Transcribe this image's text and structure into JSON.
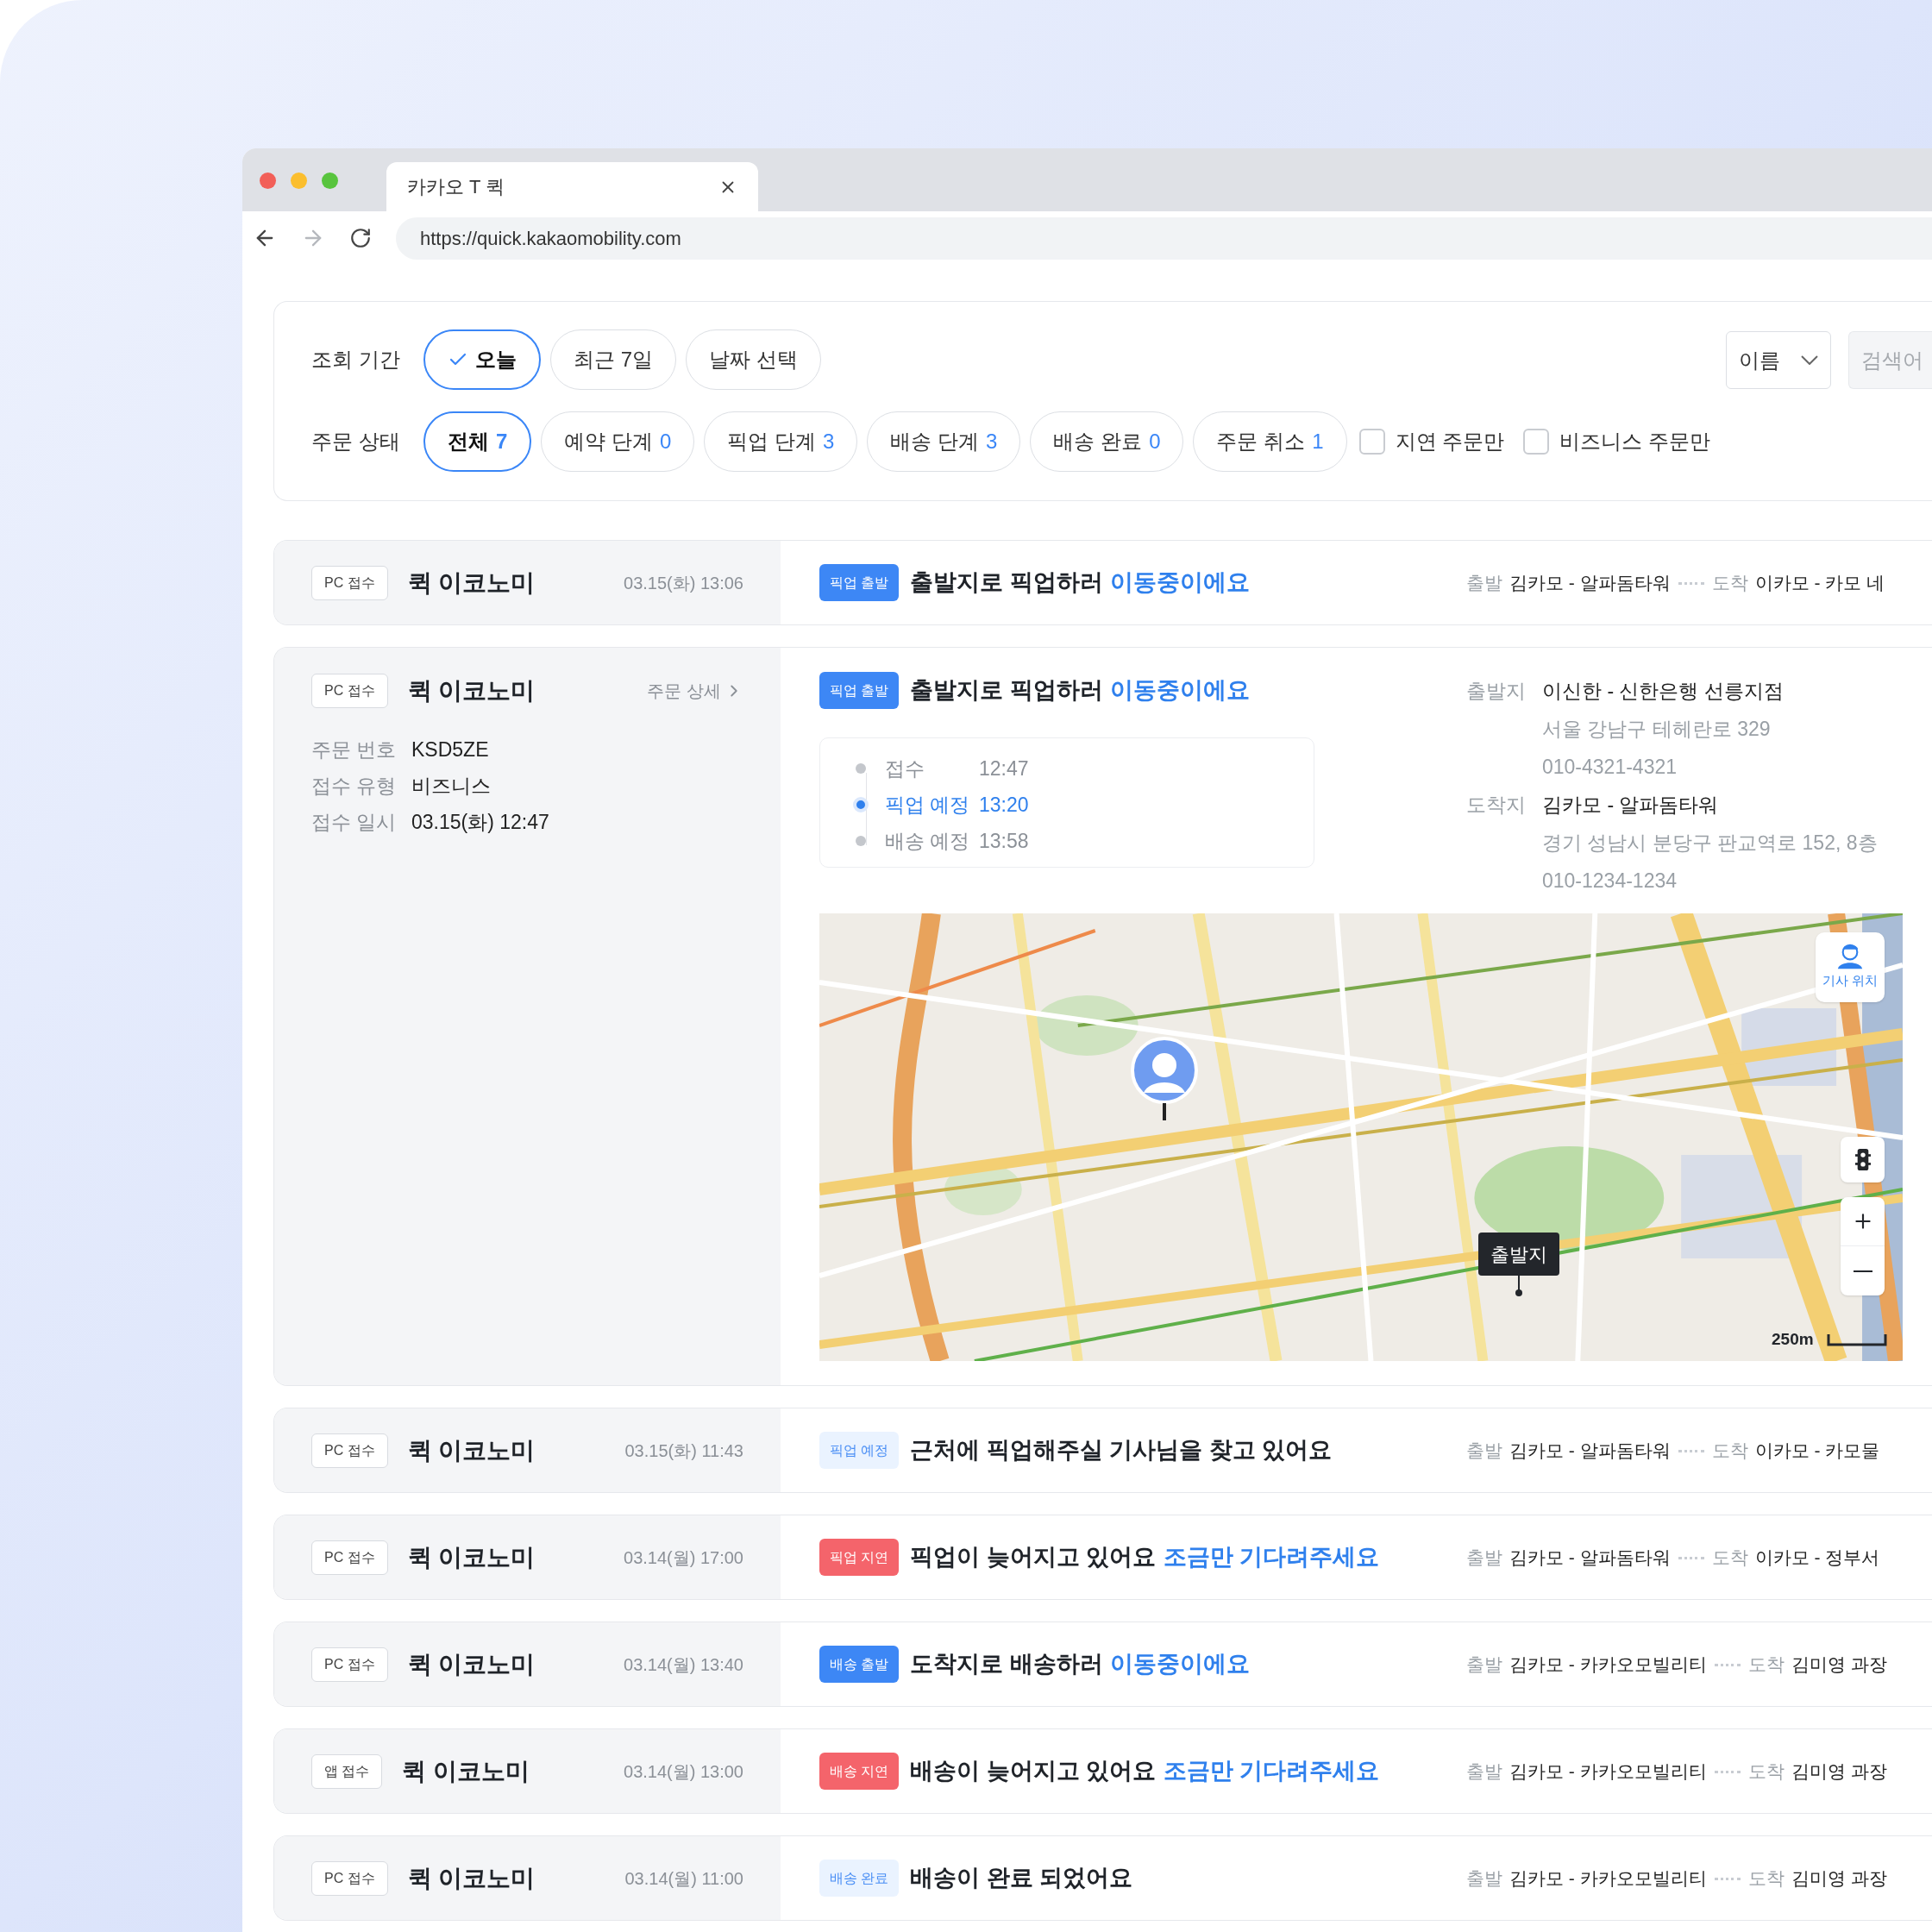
{
  "browser": {
    "tab_title": "카카오 T 퀵",
    "url": "https://quick.kakaomobility.com"
  },
  "filters": {
    "period_label": "조회 기간",
    "period_options": [
      {
        "label": "오늘",
        "selected": true
      },
      {
        "label": "최근 7일",
        "selected": false
      },
      {
        "label": "날짜 선택",
        "selected": false
      }
    ],
    "sort": "이름",
    "search_placeholder": "검색어",
    "status_label": "주문 상태",
    "status_options": [
      {
        "label": "전체",
        "count": "7",
        "selected": true
      },
      {
        "label": "예약 단계",
        "count": "0",
        "selected": false
      },
      {
        "label": "픽업 단계",
        "count": "3",
        "selected": false
      },
      {
        "label": "배송 단계",
        "count": "3",
        "selected": false
      },
      {
        "label": "배송 완료",
        "count": "0",
        "selected": false
      },
      {
        "label": "주문 취소",
        "count": "1",
        "selected": false
      }
    ],
    "checkboxes": [
      {
        "label": "지연 주문만",
        "checked": false
      },
      {
        "label": "비즈니스 주문만",
        "checked": false
      }
    ]
  },
  "orders": [
    {
      "expanded": false,
      "channel": "PC 접수",
      "service": "퀵 이코노미",
      "time": "03.15(화) 13:06",
      "badge": {
        "label": "픽업 출발",
        "kind": "solid"
      },
      "message": "출발지로 픽업하러",
      "highlight": "이동중이에요",
      "from_label": "출발",
      "from": "김카모 - 알파돔타워",
      "to_label": "도착",
      "to": "이카모 - 카모 네"
    },
    {
      "expanded": true,
      "channel": "PC 접수",
      "service": "퀵 이코노미",
      "detail_link": "주문 상세",
      "badge": {
        "label": "픽업 출발",
        "kind": "solid"
      },
      "message": "출발지로 픽업하러",
      "highlight": "이동중이에요",
      "info": [
        {
          "label": "주문 번호",
          "value": "KSD5ZE"
        },
        {
          "label": "접수 유형",
          "value": "비즈니스"
        },
        {
          "label": "접수 일시",
          "value": "03.15(화) 12:47"
        }
      ],
      "timeline": [
        {
          "label": "접수",
          "time": "12:47",
          "current": false
        },
        {
          "label": "픽업 예정",
          "time": "13:20",
          "current": true
        },
        {
          "label": "배송 예정",
          "time": "13:58",
          "current": false
        }
      ],
      "places": [
        {
          "label": "출발지",
          "name": "이신한 - 신한은행 선릉지점",
          "address": "서울 강남구 테헤란로 329",
          "phone": "010-4321-4321"
        },
        {
          "label": "도착지",
          "name": "김카모 - 알파돔타워",
          "address": "경기 성남시 분당구 판교역로 152, 8층",
          "phone": "010-1234-1234"
        }
      ],
      "map": {
        "driver_button": "기사 위치",
        "origin_label": "출발지",
        "scale": "250m"
      }
    },
    {
      "expanded": false,
      "channel": "PC 접수",
      "service": "퀵 이코노미",
      "time": "03.15(화) 11:43",
      "badge": {
        "label": "픽업 예정",
        "kind": "soft"
      },
      "message": "근처에 픽업해주실 기사님을 찾고 있어요",
      "from_label": "출발",
      "from": "김카모 - 알파돔타워",
      "to_label": "도착",
      "to": "이카모 - 카모물"
    },
    {
      "expanded": false,
      "channel": "PC 접수",
      "service": "퀵 이코노미",
      "time": "03.14(월) 17:00",
      "badge": {
        "label": "픽업 지연",
        "kind": "alert"
      },
      "message": "픽업이 늦어지고 있어요",
      "highlight": "조금만 기다려주세요",
      "from_label": "출발",
      "from": "김카모 - 알파돔타워",
      "to_label": "도착",
      "to": "이카모 - 정부서"
    },
    {
      "expanded": false,
      "channel": "PC 접수",
      "service": "퀵 이코노미",
      "time": "03.14(월) 13:40",
      "badge": {
        "label": "배송 출발",
        "kind": "solid"
      },
      "message": "도착지로 배송하러",
      "highlight": "이동중이에요",
      "from_label": "출발",
      "from": "김카모 - 카카오모빌리티",
      "to_label": "도착",
      "to": "김미영 과장"
    },
    {
      "expanded": false,
      "channel": "앱 접수",
      "service": "퀵 이코노미",
      "time": "03.14(월) 13:00",
      "badge": {
        "label": "배송 지연",
        "kind": "alert"
      },
      "message": "배송이 늦어지고 있어요",
      "highlight": "조금만 기다려주세요",
      "from_label": "출발",
      "from": "김카모 - 카카오모빌리티",
      "to_label": "도착",
      "to": "김미영 과장"
    },
    {
      "expanded": false,
      "channel": "PC 접수",
      "service": "퀵 이코노미",
      "time": "03.14(월) 11:00",
      "badge": {
        "label": "배송 완료",
        "kind": "soft"
      },
      "message": "배송이 완료 되었어요",
      "from_label": "출발",
      "from": "김카모 - 카카오모빌리티",
      "to_label": "도착",
      "to": "김미영 과장"
    }
  ]
}
